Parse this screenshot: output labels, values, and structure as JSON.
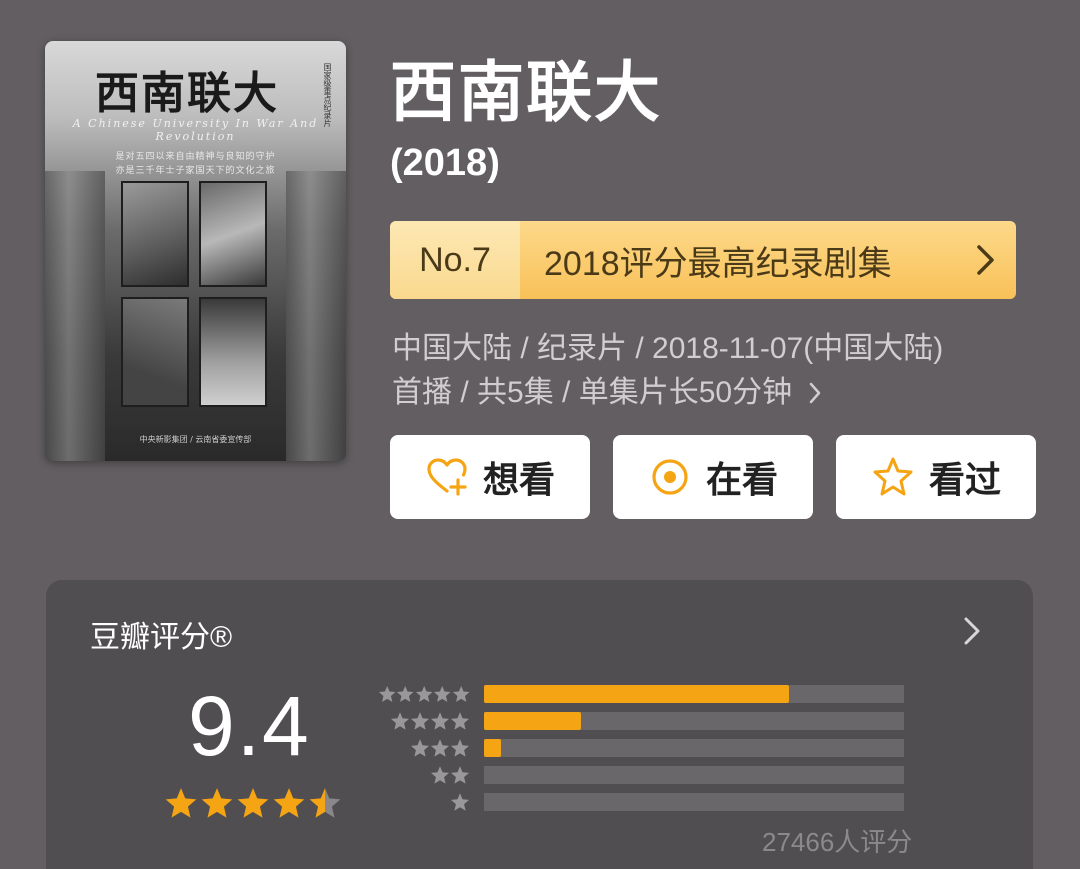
{
  "poster": {
    "title": "西南联大",
    "subtitle": "A Chinese University In War And Revolution",
    "tagline_1": "是对五四以来自由精神与良知的守护",
    "tagline_2": "亦是三千年士子家国天下的文化之旅",
    "side_text": "国家级重点纪录片",
    "footer": "中央新影集团 / 云南省委宣传部"
  },
  "title": "西南联大",
  "year": "(2018)",
  "rank": {
    "no": "No.7",
    "text": "2018评分最高纪录剧集"
  },
  "meta": {
    "line1": "中国大陆 / 纪录片 / 2018-11-07(中国大陆)",
    "line2": "首播 / 共5集 / 单集片长50分钟"
  },
  "actions": {
    "want": "想看",
    "watching": "在看",
    "watched": "看过"
  },
  "rating": {
    "label": "豆瓣评分®",
    "score": "9.4",
    "count": "27466人评分",
    "star_value": 4.5,
    "distribution": [
      {
        "stars": 5,
        "fraction": 0.727
      },
      {
        "stars": 4,
        "fraction": 0.231
      },
      {
        "stars": 3,
        "fraction": 0.036
      },
      {
        "stars": 2,
        "fraction": 0.0
      },
      {
        "stars": 1,
        "fraction": 0.0
      }
    ]
  },
  "colors": {
    "background": "#625e61",
    "accent": "#f5a414",
    "rank_banner": "#f8c158",
    "card": "#514e51"
  },
  "icons": {
    "want": "heart-plus-icon",
    "watching": "circle-dot-icon",
    "watched": "star-outline-icon",
    "more": "chevron-right-icon"
  }
}
